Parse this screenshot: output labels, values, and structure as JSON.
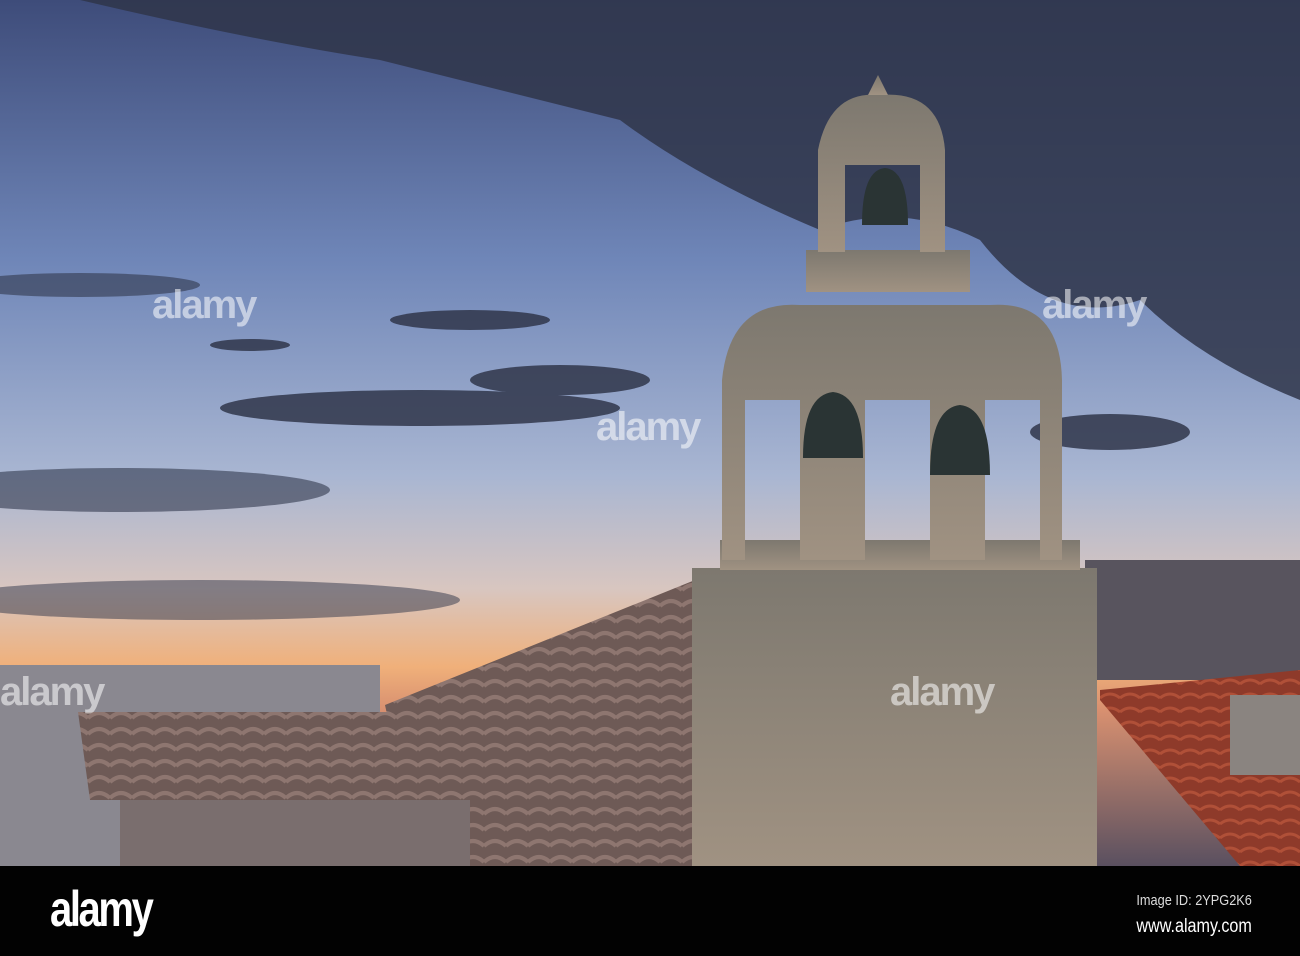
{
  "photo": {
    "subject": "Stone bell tower with three bells over tiled rooftops at dusk",
    "watermark": "alamy",
    "colors": {
      "sky_top": "#465684",
      "sky_mid": "#9aaed0",
      "horizon": "#f2a66a",
      "cloud": "#30364a",
      "stone": "#8c857b",
      "roof_red": "#8e3a2a"
    }
  },
  "footer": {
    "logo": "alamy",
    "image_id": "Image ID: 2YPG2K6",
    "url": "www.alamy.com"
  }
}
